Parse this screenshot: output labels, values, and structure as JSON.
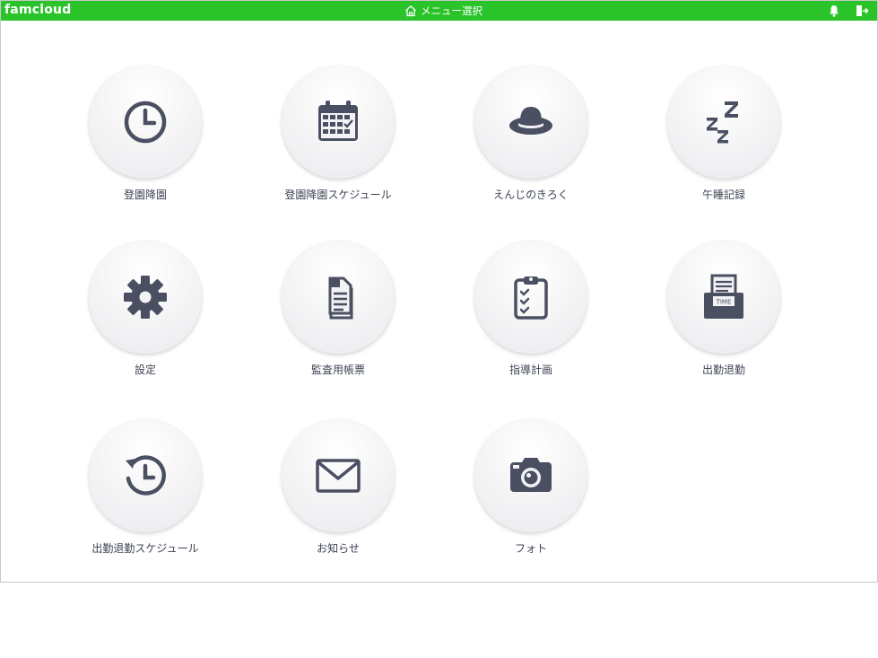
{
  "header": {
    "logo": "famcloud",
    "title": "メニュー選択",
    "home_icon": "home-icon",
    "bell_icon": "bell-icon",
    "logout_icon": "logout-icon",
    "bar_color": "#2ac32a"
  },
  "menu": {
    "icon_color": "#4a4f62",
    "items": [
      {
        "label": "登園降園",
        "icon": "clock-icon"
      },
      {
        "label": "登園降園スケジュール",
        "icon": "calendar-icon"
      },
      {
        "label": "えんじのきろく",
        "icon": "hat-icon"
      },
      {
        "label": "午睡記録",
        "icon": "sleep-zzz-icon"
      },
      {
        "label": "設定",
        "icon": "gear-icon"
      },
      {
        "label": "監査用帳票",
        "icon": "documents-icon"
      },
      {
        "label": "指導計画",
        "icon": "clipboard-checklist-icon"
      },
      {
        "label": "出勤退勤",
        "icon": "time-card-icon"
      },
      {
        "label": "出勤退勤スケジュール",
        "icon": "history-clock-icon"
      },
      {
        "label": "お知らせ",
        "icon": "envelope-icon"
      },
      {
        "label": "フォト",
        "icon": "camera-icon"
      }
    ]
  }
}
